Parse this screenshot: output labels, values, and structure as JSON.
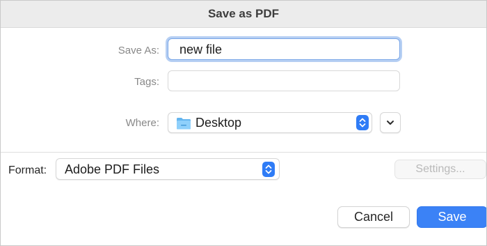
{
  "window": {
    "title": "Save as PDF"
  },
  "save_as": {
    "label": "Save As:",
    "value": "new file"
  },
  "tags": {
    "label": "Tags:",
    "value": ""
  },
  "where": {
    "label": "Where:",
    "value": "Desktop",
    "icon": "folder-icon",
    "expand_icon": "chevron-down-icon"
  },
  "format": {
    "label": "Format:",
    "value": "Adobe PDF Files"
  },
  "buttons": {
    "settings": "Settings...",
    "cancel": "Cancel",
    "save": "Save"
  },
  "colors": {
    "accent": "#3b82f6",
    "focus_ring": "#b6cff3",
    "folder": "#64b5ef"
  }
}
